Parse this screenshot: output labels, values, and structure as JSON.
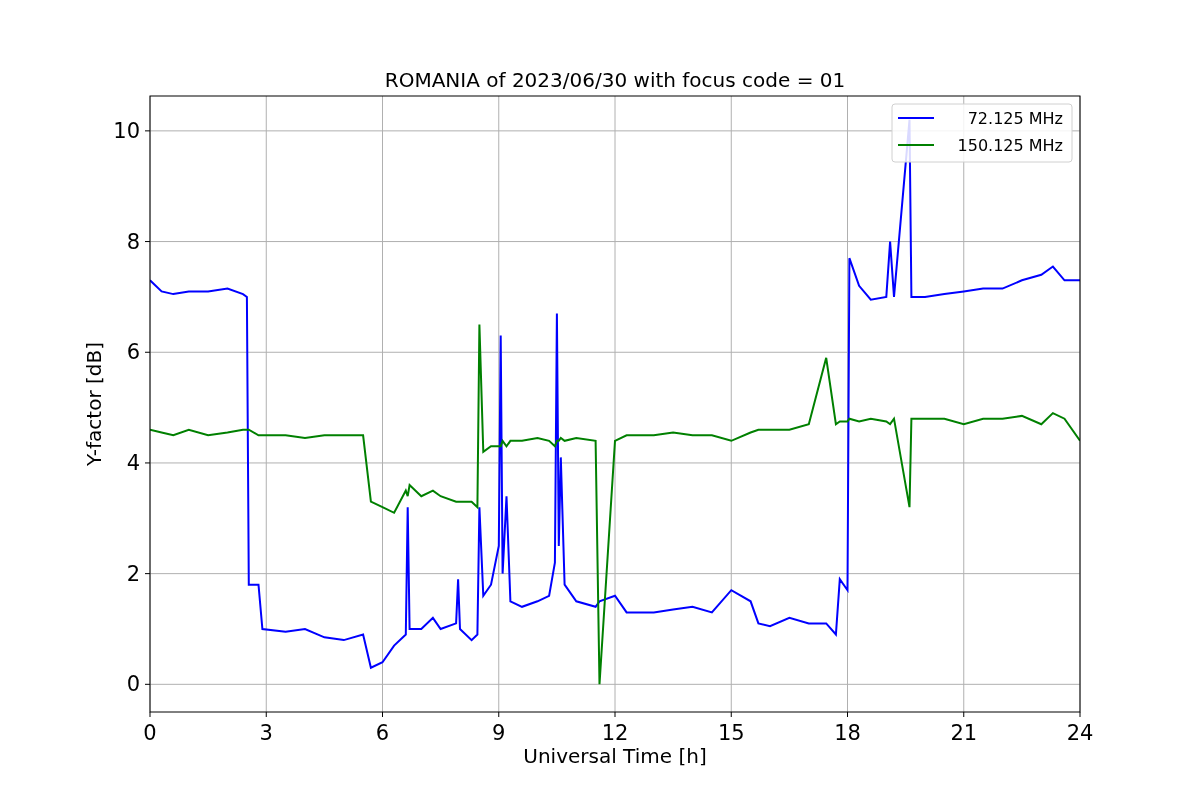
{
  "figure": {
    "chart_data": {
      "type": "line",
      "title": "ROMANIA of 2023/06/30 with focus code = 01",
      "xlabel": "Universal Time [h]",
      "ylabel": "Y-factor [dB]",
      "xlim": [
        0,
        24
      ],
      "ylim": [
        -0.5,
        10.63
      ],
      "xticks": [
        0,
        3,
        6,
        9,
        12,
        15,
        18,
        21,
        24
      ],
      "yticks": [
        0,
        2,
        4,
        6,
        8,
        10
      ],
      "grid": true,
      "legend": true,
      "x": [
        0,
        0.3,
        0.6,
        1,
        1.5,
        2,
        2.4,
        2.5,
        2.55,
        2.8,
        2.9,
        3.5,
        4,
        4.5,
        5,
        5.5,
        5.7,
        6,
        6.3,
        6.6,
        6.65,
        6.7,
        7,
        7.3,
        7.5,
        7.9,
        7.95,
        8,
        8.3,
        8.45,
        8.5,
        8.6,
        8.8,
        9,
        9.05,
        9.1,
        9.2,
        9.3,
        9.6,
        10,
        10.3,
        10.45,
        10.5,
        10.55,
        10.6,
        10.7,
        11,
        11.5,
        11.6,
        12,
        12.3,
        13,
        13.5,
        14,
        14.5,
        15,
        15.5,
        15.7,
        16,
        16.5,
        17,
        17.45,
        17.7,
        17.8,
        18,
        18.05,
        18.3,
        18.6,
        19,
        19.1,
        19.2,
        19.6,
        19.65,
        20,
        20.5,
        21,
        21.5,
        22,
        22.5,
        23,
        23.3,
        23.6,
        24
      ],
      "series": [
        {
          "name": "72.125 MHz",
          "color": "#0000ff",
          "values": [
            7.3,
            7.1,
            7.05,
            7.1,
            7.1,
            7.15,
            7.05,
            7.0,
            1.8,
            1.8,
            1.0,
            0.95,
            1.0,
            0.85,
            0.8,
            0.9,
            0.3,
            0.4,
            0.7,
            0.9,
            3.2,
            1.0,
            1.0,
            1.2,
            1.0,
            1.1,
            1.9,
            1.0,
            0.8,
            0.9,
            3.2,
            1.6,
            1.8,
            2.5,
            6.3,
            2.0,
            3.4,
            1.5,
            1.4,
            1.5,
            1.6,
            2.2,
            6.7,
            2.5,
            4.1,
            1.8,
            1.5,
            1.4,
            1.5,
            1.6,
            1.3,
            1.3,
            1.35,
            1.4,
            1.3,
            1.7,
            1.5,
            1.1,
            1.05,
            1.2,
            1.1,
            1.1,
            0.9,
            1.9,
            1.7,
            7.7,
            7.2,
            6.95,
            7.0,
            8.0,
            7.0,
            10.2,
            7.0,
            7.0,
            7.05,
            7.1,
            7.15,
            7.15,
            7.3,
            7.4,
            7.55,
            7.3,
            7.3
          ]
        },
        {
          "name": "150.125 MHz",
          "color": "#008000",
          "values": [
            4.6,
            4.55,
            4.5,
            4.6,
            4.5,
            4.55,
            4.6,
            4.6,
            4.6,
            4.5,
            4.5,
            4.5,
            4.45,
            4.5,
            4.5,
            4.5,
            3.3,
            3.2,
            3.1,
            3.5,
            3.4,
            3.6,
            3.4,
            3.5,
            3.4,
            3.3,
            3.3,
            3.3,
            3.3,
            3.2,
            6.5,
            4.2,
            4.3,
            4.3,
            4.3,
            4.4,
            4.3,
            4.4,
            4.4,
            4.45,
            4.4,
            4.3,
            4.4,
            4.4,
            4.45,
            4.4,
            4.45,
            4.4,
            0.0,
            4.4,
            4.5,
            4.5,
            4.55,
            4.5,
            4.5,
            4.4,
            4.55,
            4.6,
            4.6,
            4.6,
            4.7,
            5.9,
            4.7,
            4.75,
            4.75,
            4.8,
            4.75,
            4.8,
            4.75,
            4.7,
            4.8,
            3.2,
            4.8,
            4.8,
            4.8,
            4.7,
            4.8,
            4.8,
            4.85,
            4.7,
            4.9,
            4.8,
            4.4
          ]
        }
      ]
    }
  }
}
